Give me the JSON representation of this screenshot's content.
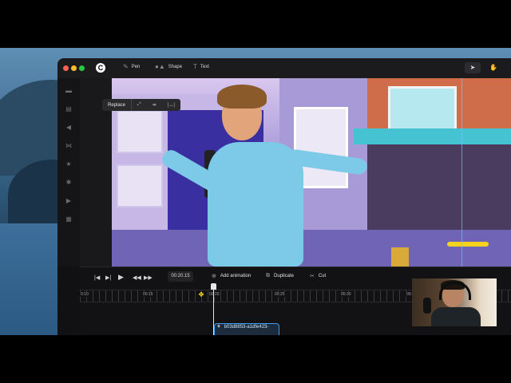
{
  "window": {
    "logo": "C"
  },
  "toolbar": {
    "tools": [
      {
        "label": "Pen",
        "icon": "pen-icon"
      },
      {
        "label": "Shape",
        "icon": "shape-icon"
      },
      {
        "label": "Text",
        "icon": "text-icon"
      }
    ],
    "right": [
      {
        "icon": "pointer-icon"
      },
      {
        "icon": "hand-icon"
      }
    ]
  },
  "sidebar": {
    "icons": [
      "folder-icon",
      "clip-icon",
      "sound-icon",
      "transition-icon",
      "star-icon",
      "settings-icon",
      "video-icon",
      "layers-icon"
    ]
  },
  "selection": {
    "replace_label": "Replace",
    "icons": [
      "expand-icon",
      "swap-icon",
      "trim-icon"
    ]
  },
  "timeline": {
    "time": "00:20.15",
    "actions": [
      {
        "label": "Add animation",
        "icon": "add-animation-icon"
      },
      {
        "label": "Duplicate",
        "icon": "duplicate-icon"
      },
      {
        "label": "Cut",
        "icon": "cut-icon"
      }
    ],
    "ruler": [
      "0:10",
      "00:15",
      "00:20",
      "00:25",
      "00:30",
      "00:35"
    ],
    "clip_label": "b03d8853-a1dfe423-"
  },
  "colors": {
    "accent": "#3b9cf0",
    "marker": "#f5d21e"
  }
}
